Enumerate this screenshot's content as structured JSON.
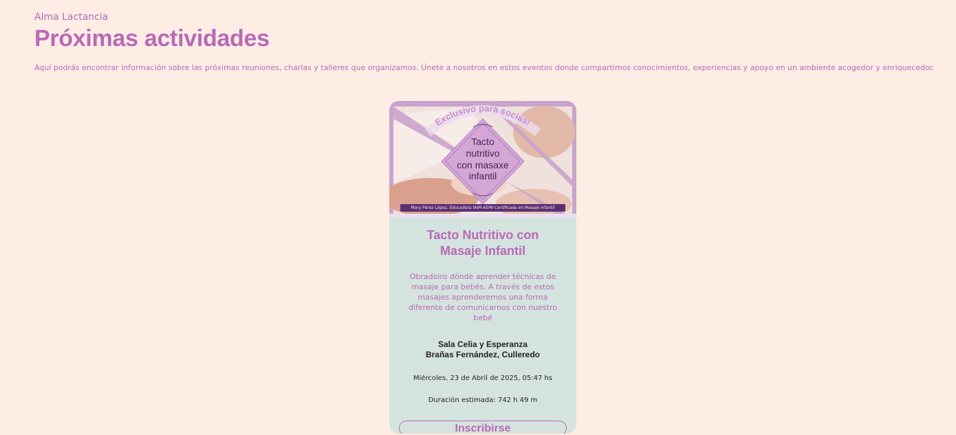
{
  "org_name": "Alma Lactancia",
  "page_title": "Próximas actividades",
  "intro": "Aquí podrás encontrar información sobre las próximas reuniones, charlas y talleres que organizamos. Únete a nosotros en estos eventos donde compartimos conocimientos, experiencias y apoyo en un ambiente acogedor y enriquecedor.",
  "event": {
    "poster": {
      "arc_text": "Exclusivo para socias!",
      "diamond_lines": [
        "Tacto",
        "nutritivo",
        "con masaxe",
        "infantil"
      ],
      "banner": "Mary Pérez López, Educadora IAIM-AEMI Certificada en Masaje infantil"
    },
    "title": "Tacto Nutritivo con Masaje Infantil",
    "description": "Obradoiro dónde aprender técnicas de masaje para bebés.  A través de estos masajes aprenderemos una forma diferente de comunicarnos con nuestro bebé",
    "location_line1": "Sala Celia y Esperanza",
    "location_line2": "Brañas Fernández, Culleredo",
    "datetime": "Miércoles, 23 de Abril de 2025, 05:47 hs",
    "duration": "Duración estimada: 742 h 49 m",
    "button_label": "Inscribirse"
  },
  "colors": {
    "background": "#fdede5",
    "accent": "#b86ab6",
    "card": "#d5e3de",
    "poster_purple": "#c9a3cc",
    "text_dark": "#222222"
  }
}
